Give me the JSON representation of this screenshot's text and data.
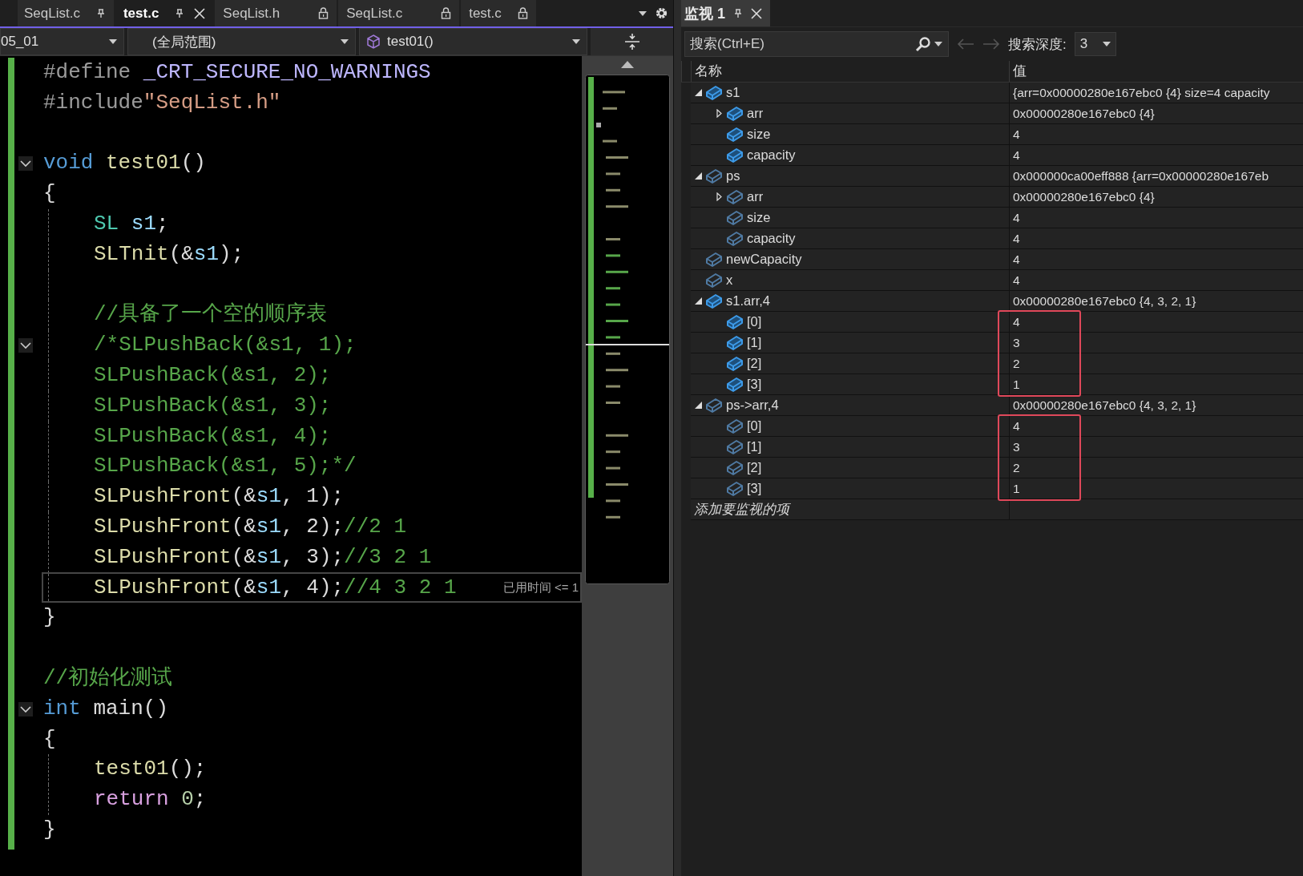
{
  "editor": {
    "tabs": [
      {
        "label": "SeqList.c",
        "selected": false,
        "pinned": true,
        "locked": false
      },
      {
        "label": "test.c",
        "selected": true,
        "pinned": true,
        "locked": false
      },
      {
        "label": "SeqList.h",
        "selected": false,
        "pinned": false,
        "locked": true
      },
      {
        "label": "SeqList.c",
        "selected": false,
        "pinned": false,
        "locked": true
      },
      {
        "label": "test.c",
        "selected": false,
        "pinned": false,
        "locked": true
      }
    ],
    "nav": {
      "project": "05_01",
      "scope": "(全局范围)",
      "member": "test01()"
    },
    "code": [
      {
        "kind": "code",
        "fold": false,
        "current": false,
        "tokens": [
          {
            "text": "#define ",
            "kind": "preproc"
          },
          {
            "text": "_CRT_SECURE_NO_WARNINGS",
            "kind": "macro"
          }
        ]
      },
      {
        "kind": "code",
        "fold": false,
        "current": false,
        "tokens": [
          {
            "text": "#include",
            "kind": "preproc"
          },
          {
            "text": "\"SeqList.h\"",
            "kind": "string"
          }
        ]
      },
      {
        "kind": "blank"
      },
      {
        "kind": "code",
        "fold": true,
        "current": false,
        "tokens": [
          {
            "text": "void ",
            "kind": "keyword"
          },
          {
            "text": "test01",
            "kind": "func"
          },
          {
            "text": "()",
            "kind": "punct"
          }
        ]
      },
      {
        "kind": "code",
        "fold": false,
        "current": false,
        "tokens": [
          {
            "text": "{",
            "kind": "punct"
          }
        ],
        "children": [
          {
            "kind": "code",
            "fold": false,
            "current": false,
            "tokens": [
              {
                "text": "SL ",
                "kind": "type"
              },
              {
                "text": "s1",
                "kind": "var"
              },
              {
                "text": ";",
                "kind": "punct"
              }
            ]
          },
          {
            "kind": "code",
            "fold": false,
            "current": false,
            "tokens": [
              {
                "text": "SLTnit",
                "kind": "func"
              },
              {
                "text": "(&",
                "kind": "punct"
              },
              {
                "text": "s1",
                "kind": "var"
              },
              {
                "text": ");",
                "kind": "punct"
              }
            ]
          },
          {
            "kind": "blank"
          },
          {
            "kind": "code",
            "fold": false,
            "current": false,
            "tokens": [
              {
                "text": "//具备了一个空的顺序表",
                "kind": "comment"
              }
            ]
          },
          {
            "kind": "code",
            "fold": true,
            "current": false,
            "tokens": [
              {
                "text": "/*SLPushBack(&s1, 1);",
                "kind": "comment"
              }
            ]
          },
          {
            "kind": "code",
            "fold": false,
            "current": false,
            "tokens": [
              {
                "text": "SLPushBack(&s1, 2);",
                "kind": "comment"
              }
            ]
          },
          {
            "kind": "code",
            "fold": false,
            "current": false,
            "tokens": [
              {
                "text": "SLPushBack(&s1, 3);",
                "kind": "comment"
              }
            ]
          },
          {
            "kind": "code",
            "fold": false,
            "current": false,
            "tokens": [
              {
                "text": "SLPushBack(&s1, 4);",
                "kind": "comment"
              }
            ]
          },
          {
            "kind": "code",
            "fold": false,
            "current": false,
            "tokens": [
              {
                "text": "SLPushBack(&s1, 5);*/",
                "kind": "comment"
              }
            ]
          },
          {
            "kind": "code",
            "fold": false,
            "current": false,
            "tokens": [
              {
                "text": "SLPushFront",
                "kind": "func"
              },
              {
                "text": "(&",
                "kind": "punct"
              },
              {
                "text": "s1",
                "kind": "var"
              },
              {
                "text": ", 1);",
                "kind": "punct"
              }
            ]
          },
          {
            "kind": "code",
            "fold": false,
            "current": false,
            "tokens": [
              {
                "text": "SLPushFront",
                "kind": "func"
              },
              {
                "text": "(&",
                "kind": "punct"
              },
              {
                "text": "s1",
                "kind": "var"
              },
              {
                "text": ", 2);",
                "kind": "punct"
              },
              {
                "text": "//2 1",
                "kind": "comment"
              }
            ]
          },
          {
            "kind": "code",
            "fold": false,
            "current": false,
            "tokens": [
              {
                "text": "SLPushFront",
                "kind": "func"
              },
              {
                "text": "(&",
                "kind": "punct"
              },
              {
                "text": "s1",
                "kind": "var"
              },
              {
                "text": ", 3);",
                "kind": "punct"
              },
              {
                "text": "//3 2 1",
                "kind": "comment"
              }
            ]
          },
          {
            "kind": "code",
            "fold": false,
            "current": true,
            "hint": "已用时间 <= 1",
            "tokens": [
              {
                "text": "SLPushFront",
                "kind": "func"
              },
              {
                "text": "(&",
                "kind": "punct"
              },
              {
                "text": "s1",
                "kind": "var"
              },
              {
                "text": ", 4);",
                "kind": "punct"
              },
              {
                "text": "//4 3 2 1",
                "kind": "comment"
              }
            ]
          }
        ]
      },
      {
        "kind": "code",
        "fold": false,
        "current": false,
        "tokens": [
          {
            "text": "}",
            "kind": "punct"
          }
        ]
      },
      {
        "kind": "blank"
      },
      {
        "kind": "code",
        "fold": false,
        "current": false,
        "tokens": [
          {
            "text": "//初始化测试",
            "kind": "comment"
          }
        ]
      },
      {
        "kind": "code",
        "fold": true,
        "current": false,
        "tokens": [
          {
            "text": "int",
            "kind": "keyword"
          },
          {
            "text": " main()",
            "kind": "punct"
          }
        ]
      },
      {
        "kind": "code",
        "fold": false,
        "current": false,
        "tokens": [
          {
            "text": "{",
            "kind": "punct"
          }
        ],
        "children": [
          {
            "kind": "code",
            "fold": false,
            "current": false,
            "tokens": [
              {
                "text": "test01",
                "kind": "func"
              },
              {
                "text": "();",
                "kind": "punct"
              }
            ]
          },
          {
            "kind": "code",
            "fold": false,
            "current": false,
            "tokens": [
              {
                "text": "return",
                "kind": "control"
              },
              {
                "text": " 0",
                "kind": "number"
              },
              {
                "text": ";",
                "kind": "punct"
              }
            ]
          }
        ]
      },
      {
        "kind": "code",
        "fold": false,
        "current": false,
        "tokens": [
          {
            "text": "}",
            "kind": "punct"
          }
        ]
      }
    ]
  },
  "watch": {
    "title": "监视 1",
    "search": {
      "placeholder": "搜索(Ctrl+E)"
    },
    "depth_label": "搜索深度:",
    "depth": "3",
    "columns": [
      "名称",
      "值"
    ],
    "items": [
      {
        "name": "s1",
        "value": "{arr=0x00000280e167ebc0 {4} size=4 capacity",
        "highlighted": true,
        "expanded": true,
        "children_outlined": false,
        "children": [
          {
            "name": "arr",
            "value": "0x00000280e167ebc0 {4}",
            "highlighted": true,
            "expanded": false
          },
          {
            "name": "size",
            "value": "4",
            "highlighted": true
          },
          {
            "name": "capacity",
            "value": "4",
            "highlighted": true
          }
        ]
      },
      {
        "name": "ps",
        "value": "0x000000ca00eff888 {arr=0x00000280e167eb",
        "highlighted": false,
        "expanded": true,
        "children_outlined": false,
        "children": [
          {
            "name": "arr",
            "value": "0x00000280e167ebc0 {4}",
            "highlighted": false,
            "expanded": false
          },
          {
            "name": "size",
            "value": "4",
            "highlighted": false
          },
          {
            "name": "capacity",
            "value": "4",
            "highlighted": false
          }
        ]
      },
      {
        "name": "newCapacity",
        "value": "4",
        "highlighted": false
      },
      {
        "name": "x",
        "value": "4",
        "highlighted": false
      },
      {
        "name": "s1.arr,4",
        "value": "0x00000280e167ebc0 {4, 3, 2, 1}",
        "highlighted": true,
        "expanded": true,
        "children_outlined": true,
        "children": [
          {
            "name": "[0]",
            "value": "4",
            "highlighted": true
          },
          {
            "name": "[1]",
            "value": "3",
            "highlighted": true
          },
          {
            "name": "[2]",
            "value": "2",
            "highlighted": true
          },
          {
            "name": "[3]",
            "value": "1",
            "highlighted": true
          }
        ]
      },
      {
        "name": "ps->arr,4",
        "value": "0x00000280e167ebc0 {4, 3, 2, 1}",
        "highlighted": false,
        "expanded": true,
        "children_outlined": true,
        "children": [
          {
            "name": "[0]",
            "value": "4",
            "highlighted": false
          },
          {
            "name": "[1]",
            "value": "3",
            "highlighted": false
          },
          {
            "name": "[2]",
            "value": "2",
            "highlighted": false
          },
          {
            "name": "[3]",
            "value": "1",
            "highlighted": false
          }
        ]
      }
    ],
    "new_item": {
      "placeholder": "添加要监视的项"
    }
  }
}
